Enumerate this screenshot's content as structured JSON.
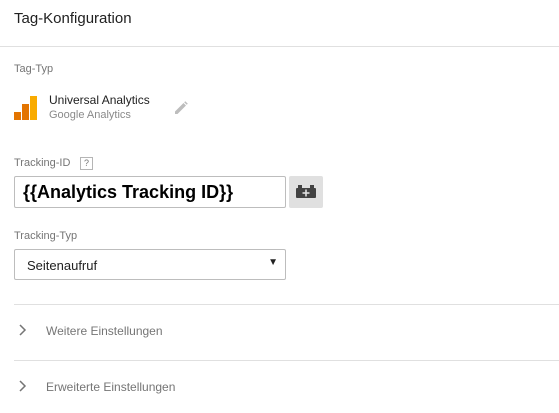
{
  "header": {
    "title": "Tag-Konfiguration"
  },
  "tag_type": {
    "label": "Tag-Typ",
    "name": "Universal Analytics",
    "subtitle": "Google Analytics",
    "icon": "google-analytics-logo",
    "edit_icon": "pencil-icon"
  },
  "tracking_id": {
    "label": "Tracking-ID",
    "help": "?",
    "value": "{{Analytics Tracking ID}}",
    "variable_button_icon": "variable-picker-icon"
  },
  "tracking_type": {
    "label": "Tracking-Typ",
    "selected": "Seitenaufruf",
    "caret": "▼"
  },
  "sections": [
    {
      "label": "Weitere Einstellungen"
    },
    {
      "label": "Erweiterte Einstellungen"
    }
  ],
  "colors": {
    "ga_orange_dark": "#E37400",
    "ga_orange": "#F9AB00",
    "text_muted": "#757575",
    "divider": "#e0e0e0"
  }
}
